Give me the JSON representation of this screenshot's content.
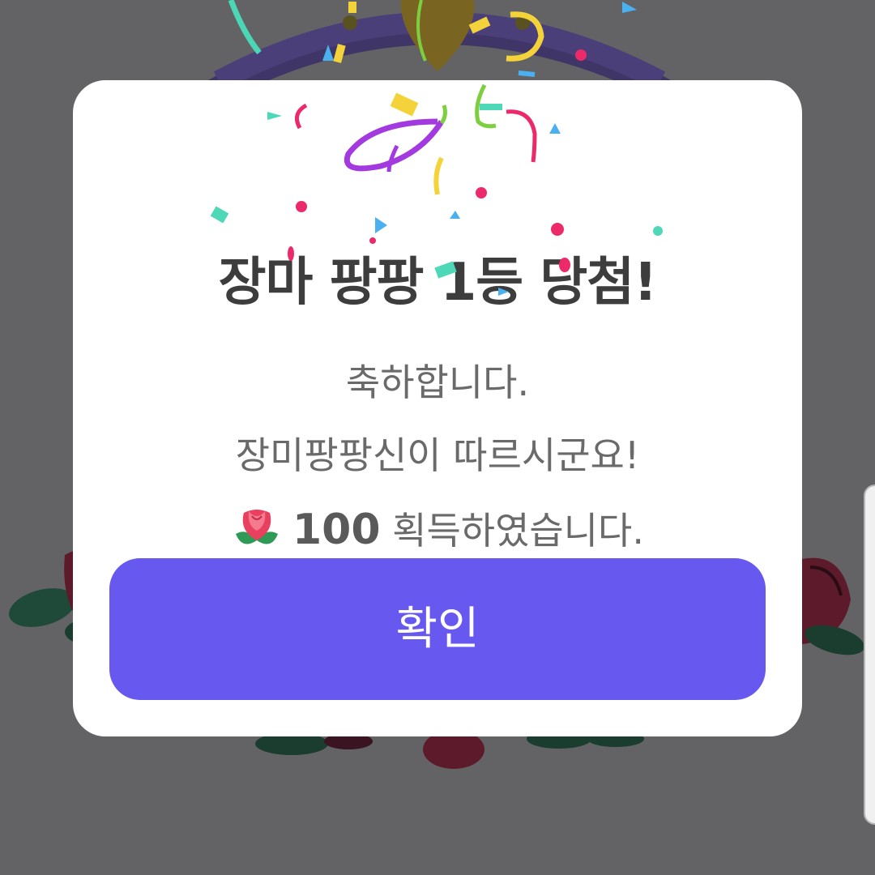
{
  "dialog": {
    "title": "장마 팡팡 1등 당첨!",
    "line1": "축하합니다.",
    "line2": "장미팡팡신이 따르시군요!",
    "reward_amount": "100",
    "reward_suffix": "획득하였습니다.",
    "reward_icon": "rose-icon",
    "confirm_label": "확인"
  },
  "colors": {
    "overlay": "#636365",
    "dialog_bg": "#ffffff",
    "button": "#6758f0",
    "title_text": "#3d3d3d",
    "body_text": "#6a6a6a"
  }
}
